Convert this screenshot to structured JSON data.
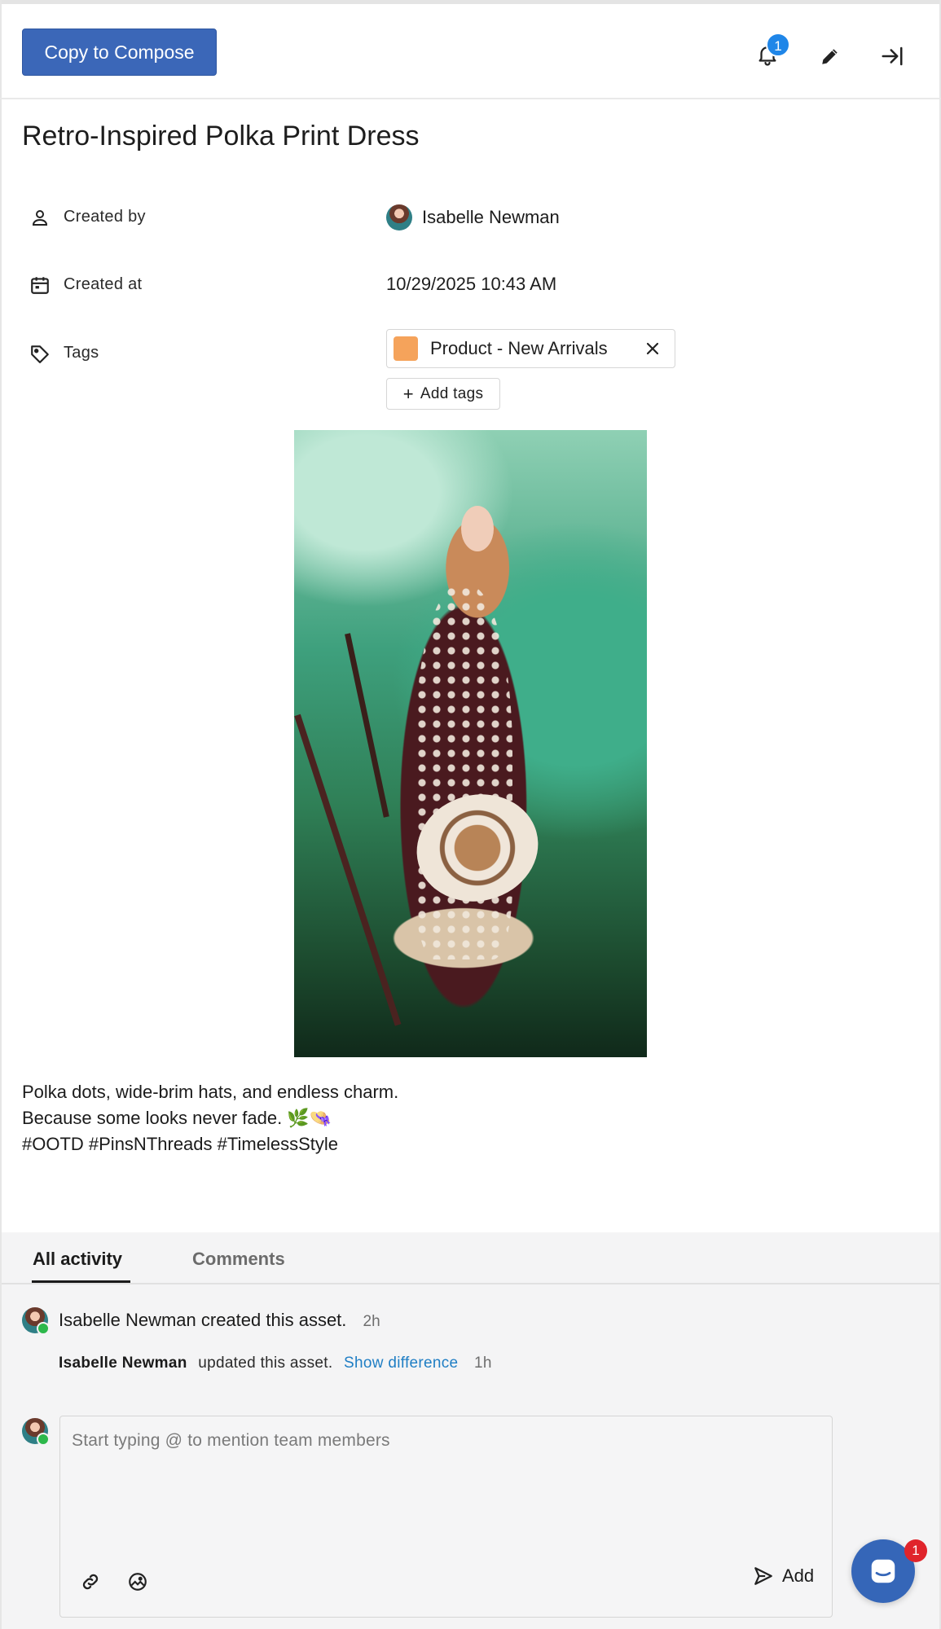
{
  "header": {
    "copy_button_label": "Copy to Compose",
    "notification_count": "1",
    "icons": [
      "bell-icon",
      "pencil-icon",
      "collapse-panel-icon"
    ]
  },
  "asset": {
    "title": "Retro-Inspired Polka Print Dress",
    "properties": {
      "created_by_label": "Created by",
      "created_by_value": "Isabelle Newman",
      "created_at_label": "Created at",
      "created_at_value": "10/29/2025 10:43 AM",
      "tags_label": "Tags"
    },
    "tags": [
      {
        "label": "Product - New Arrivals",
        "color": "#f5a35b"
      }
    ],
    "add_tags_label": "Add tags",
    "caption_lines": [
      "Polka dots, wide-brim hats, and endless charm.",
      "Because some looks never fade. 🌿👒",
      "#OOTD #PinsNThreads #TimelessStyle"
    ]
  },
  "activity": {
    "tabs": [
      "All activity",
      "Comments"
    ],
    "active_tab": "All activity",
    "entries": [
      {
        "user": "Isabelle Newman",
        "text": "created this asset.",
        "time": "2h"
      },
      {
        "user": "Isabelle Newman",
        "text": "updated this asset.",
        "link": "Show difference",
        "time": "1h"
      }
    ],
    "comment_placeholder": "Start typing @ to mention team members",
    "add_label": "Add"
  },
  "chat": {
    "badge_count": "1"
  },
  "colors": {
    "primary": "#3b67b8",
    "link": "#1f7ec4",
    "badge_blue": "#1f86e8",
    "badge_red": "#e0242b"
  }
}
